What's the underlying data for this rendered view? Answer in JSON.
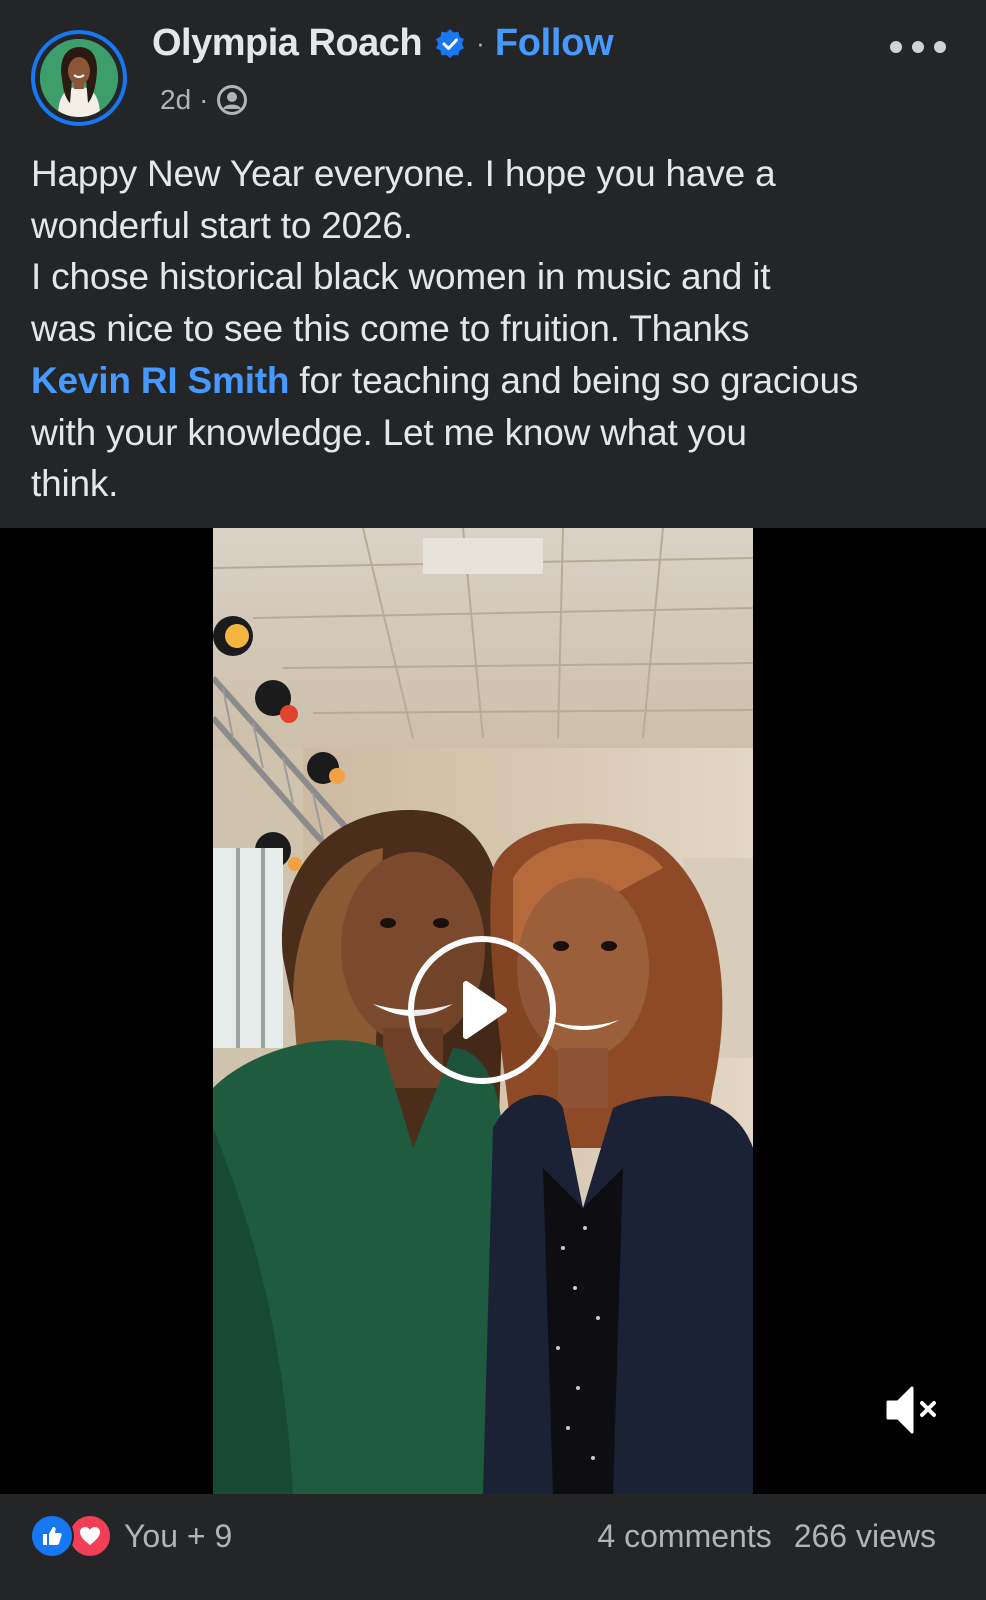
{
  "header": {
    "author_name": "Olympia Roach",
    "separator": "·",
    "follow_label": "Follow",
    "timestamp": "2d",
    "meta_separator": "·",
    "audience_icon": "friends-audience-icon",
    "verified_icon": "verified-badge-icon",
    "more_icon": "more-options-icon"
  },
  "post": {
    "line1": "Happy New Year everyone.  I hope you have a",
    "line2": "wonderful start to 2026.",
    "line3": "I chose historical black women in music and it",
    "line4": "was nice to see this come to fruition. Thanks",
    "mention": "Kevin RI Smith",
    "line5_rest": " for teaching and being so gracious",
    "line6": "with your knowledge.  Let me know what you",
    "line7": "think."
  },
  "media": {
    "type": "video",
    "play_icon": "play-icon",
    "mute_icon": "muted-speaker-icon"
  },
  "footer": {
    "reaction_like_icon": "like-reaction-icon",
    "reaction_love_icon": "love-reaction-icon",
    "reactions_text": "You + 9",
    "comments_text": "4 comments",
    "views_text": "266 views"
  },
  "colors": {
    "background": "#242526",
    "text": "#e4e6eb",
    "secondary_text": "#b0b3b8",
    "link_blue": "#4599ff",
    "brand_blue": "#1877f2",
    "love_red": "#f33e58"
  }
}
